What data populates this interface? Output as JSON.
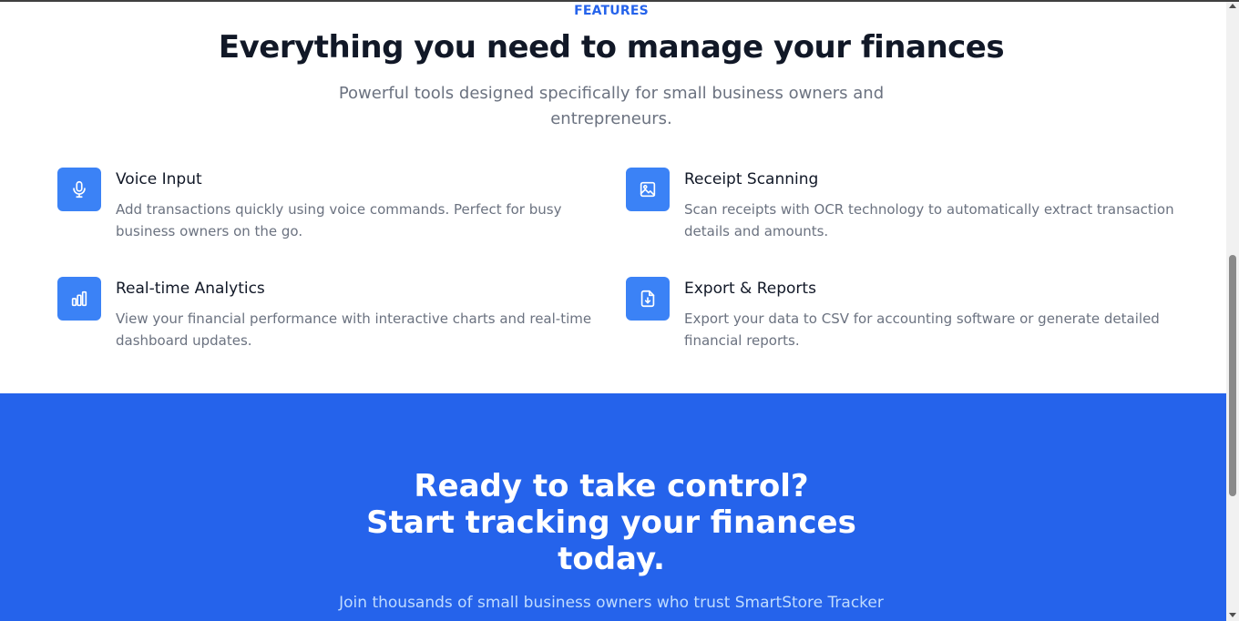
{
  "features": {
    "eyebrow": "FEATURES",
    "headline": "Everything you need to manage your finances",
    "subheadline": "Powerful tools designed specifically for small business owners and entrepreneurs.",
    "items": [
      {
        "icon": "microphone-icon",
        "title": "Voice Input",
        "description": "Add transactions quickly using voice commands. Perfect for busy business owners on the go."
      },
      {
        "icon": "image-icon",
        "title": "Receipt Scanning",
        "description": "Scan receipts with OCR technology to automatically extract transaction details and amounts."
      },
      {
        "icon": "bar-chart-icon",
        "title": "Real-time Analytics",
        "description": "View your financial performance with interactive charts and real-time dashboard updates."
      },
      {
        "icon": "file-download-icon",
        "title": "Export & Reports",
        "description": "Export your data to CSV for accounting software or generate detailed financial reports."
      }
    ]
  },
  "cta": {
    "title_line1": "Ready to take control?",
    "title_line2": "Start tracking your finances",
    "title_line3": "today.",
    "subtitle": "Join thousands of small business owners who trust SmartStore Tracker for their financial management."
  },
  "colors": {
    "accent": "#2563eb",
    "icon_bg": "#3b82f6",
    "heading": "#111827",
    "muted": "#6b7280"
  }
}
